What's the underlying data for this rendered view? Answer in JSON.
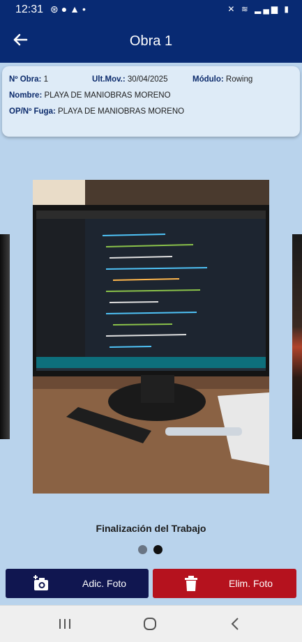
{
  "status_bar": {
    "time": "12:31"
  },
  "app_bar": {
    "title": "Obra 1"
  },
  "info": {
    "obra_label": "Nº Obra:",
    "obra_value": "1",
    "ultmov_label": "Ult.Mov.:",
    "ultmov_value": "30/04/2025",
    "modulo_label": "Módulo:",
    "modulo_value": "Rowing",
    "nombre_label": "Nombre:",
    "nombre_value": "PLAYA DE MANIOBRAS MORENO",
    "op_label": "OP/Nº Fuga:",
    "op_value": "PLAYA DE MANIOBRAS MORENO"
  },
  "carousel": {
    "caption": "Finalización del Trabajo",
    "page_count": 2,
    "active_index": 1
  },
  "buttons": {
    "add_label": "Adic. Foto",
    "delete_label": "Elim. Foto"
  },
  "colors": {
    "primary": "#082a73",
    "add_button": "#101650",
    "delete_button": "#b5121e",
    "background": "#b9d3ec"
  }
}
